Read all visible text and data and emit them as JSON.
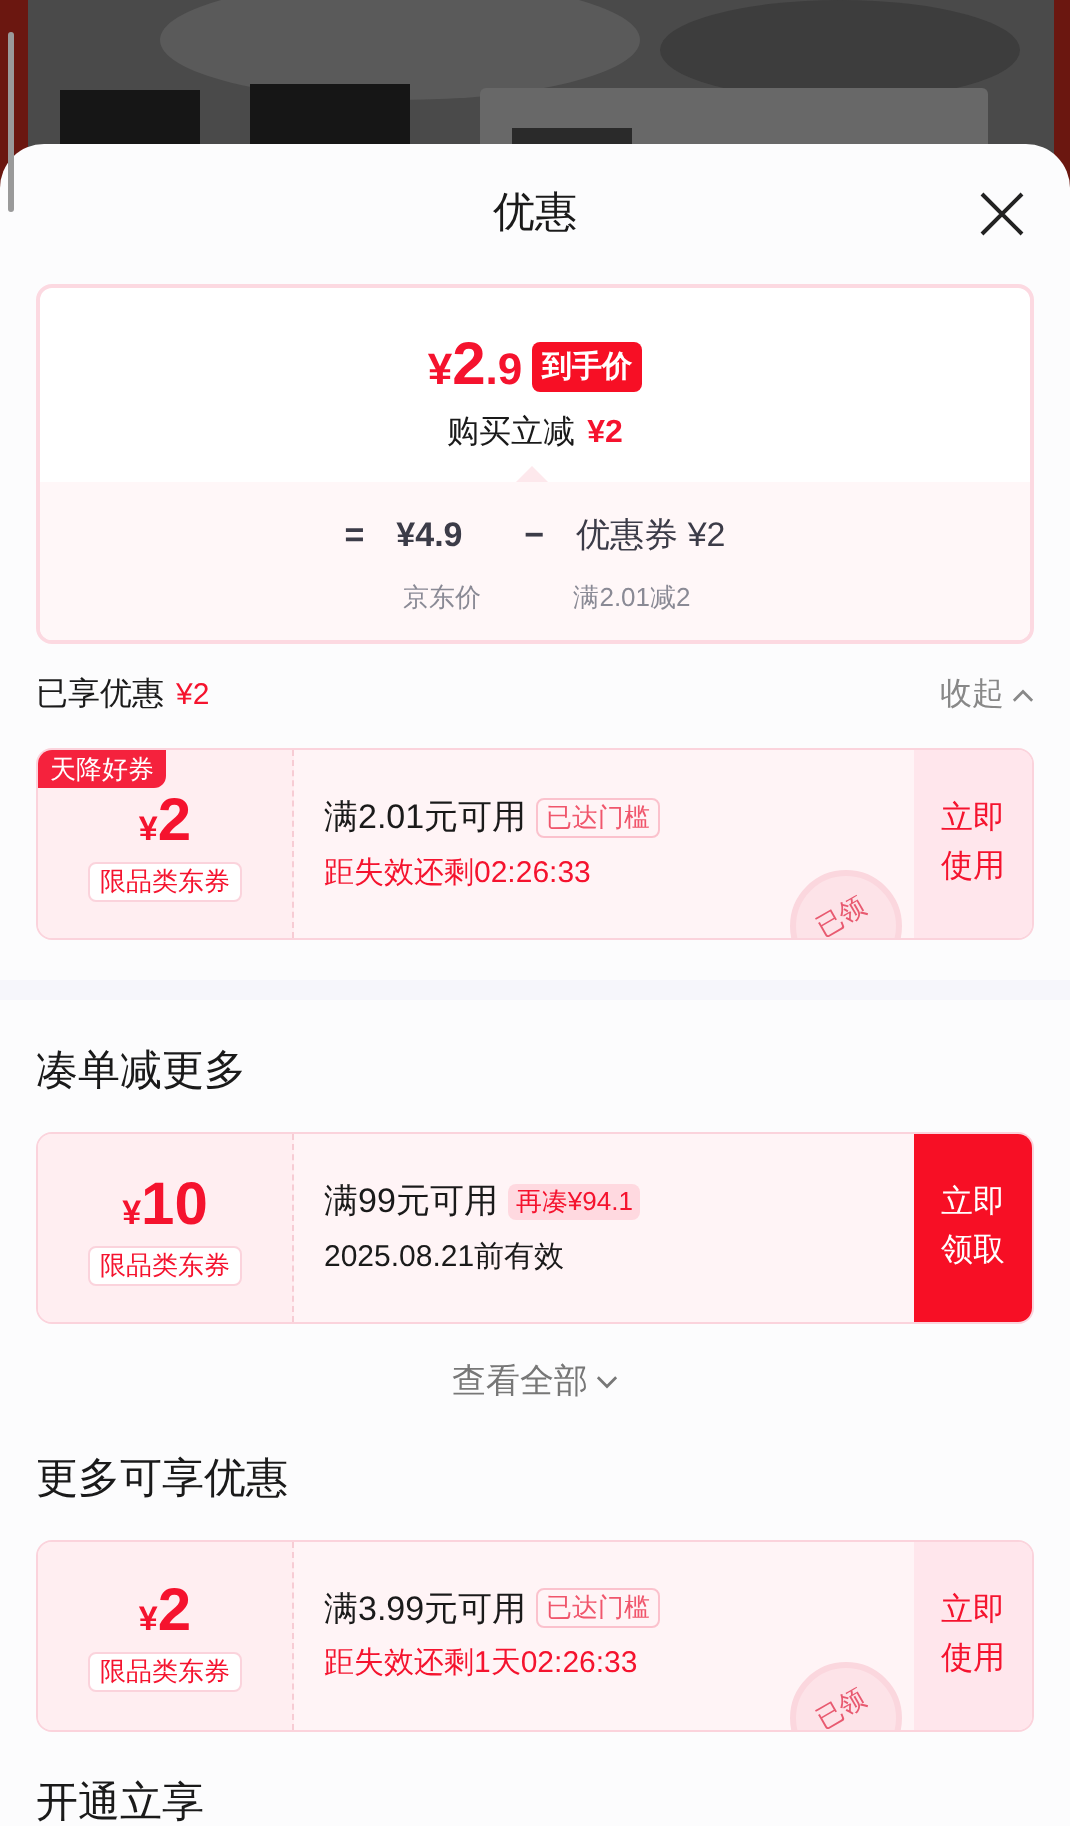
{
  "sheet": {
    "title": "优惠"
  },
  "summary": {
    "final_price_symbol": "¥",
    "final_price_int": "2",
    "final_price_dec": ".9",
    "final_price_tag": "到手价",
    "saving_label": "购买立减",
    "saving_amount": "¥2",
    "equals": "=",
    "original_price": "¥4.9",
    "minus": "−",
    "coupon_amount": "优惠券 ¥2",
    "original_price_caption": "京东价",
    "coupon_caption": "满2.01减2"
  },
  "sections": [
    {
      "title": "已享优惠",
      "amount": "¥2",
      "toggle": "收起",
      "expanded": true,
      "separator_after": true,
      "coupons": [
        {
          "kind": "claimed",
          "corner_tag": "天降好券",
          "symbol": "¥",
          "value": "2",
          "scope": "限品类东券",
          "condition": "满2.01元可用",
          "condition_tag": "已达门槛",
          "validity": "距失效还剩02:26:33",
          "action": "立即使用",
          "stamp": "已领"
        }
      ]
    },
    {
      "title": "凑单减更多",
      "more_link": "查看全部",
      "coupons": [
        {
          "kind": "claim",
          "symbol": "¥",
          "value": "10",
          "scope": "限品类东券",
          "condition": "满99元可用",
          "condition_tag": "再凑¥94.1",
          "validity": "2025.08.21前有效",
          "action": "立即领取"
        }
      ]
    },
    {
      "title": "更多可享优惠",
      "coupons": [
        {
          "kind": "claimed",
          "symbol": "¥",
          "value": "2",
          "scope": "限品类东券",
          "condition": "满3.99元可用",
          "condition_tag": "已达门槛",
          "validity": "距失效还剩1天02:26:33",
          "action": "立即使用",
          "stamp": "已领"
        }
      ]
    },
    {
      "title": "开通立享"
    }
  ]
}
